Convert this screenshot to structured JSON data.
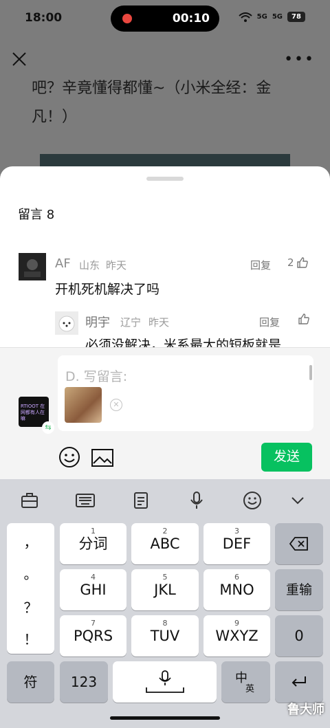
{
  "status_bar": {
    "time": "18:00",
    "recording_time": "00:10",
    "battery": "78",
    "signal_1": "5G",
    "signal_2": "5G"
  },
  "article": {
    "line1": "吧？辛竟懂得都懂~（小米全经：金",
    "line2": "凡！）"
  },
  "comments_sheet": {
    "title": "留言 8",
    "comments": [
      {
        "name": "AF",
        "location": "山东",
        "time": "昨天",
        "text": "开机死机解决了吗",
        "reply_label": "回复",
        "likes": "2"
      },
      {
        "name": "明宇",
        "location": "辽宁",
        "time": "昨天",
        "text": "必须没解决，米系最大的短板就是",
        "reply_label": "回复",
        "likes": ""
      }
    ]
  },
  "composer": {
    "placeholder": "D. 写留言:",
    "send_label": "发送",
    "my_avatar_text": "RTIOOT 在网都有人在嘛"
  },
  "keyboard": {
    "keys": [
      {
        "num": "1",
        "label": "分词"
      },
      {
        "num": "2",
        "label": "ABC"
      },
      {
        "num": "3",
        "label": "DEF"
      },
      {
        "num": "4",
        "label": "GHI"
      },
      {
        "num": "5",
        "label": "JKL"
      },
      {
        "num": "6",
        "label": "MNO"
      },
      {
        "num": "7",
        "label": "PQRS"
      },
      {
        "num": "8",
        "label": "TUV"
      },
      {
        "num": "9",
        "label": "WXYZ"
      }
    ],
    "punctuation": [
      "，",
      "。",
      "？",
      "！"
    ],
    "reenter_label": "重输",
    "zero_label": "0",
    "symbol_label": "符",
    "numbers_label": "123",
    "lang_label_top": "中",
    "lang_label_bottom": "英"
  },
  "watermark": "鲁大师",
  "colors": {
    "send_green": "#07c160",
    "keyboard_bg": "#d4d6db"
  }
}
